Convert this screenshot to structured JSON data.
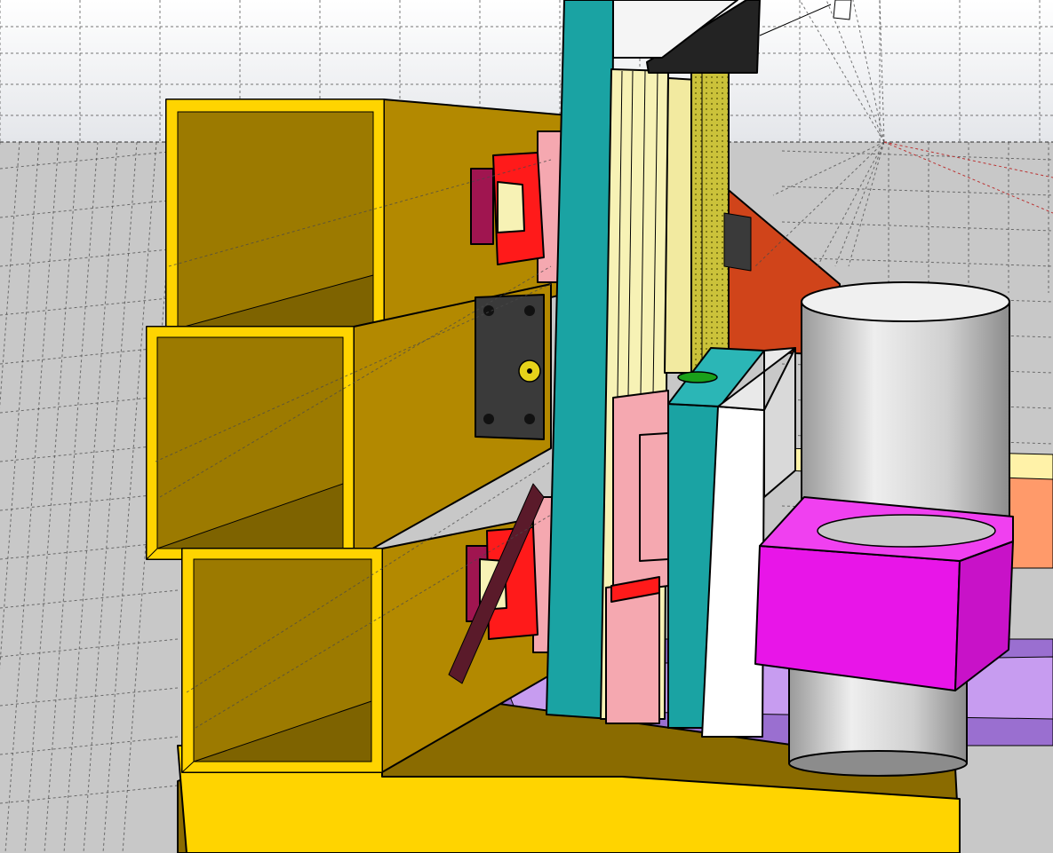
{
  "view": {
    "style": "shaded-with-hidden-lines",
    "projection": "perspective"
  },
  "colors": {
    "sky": "#eef0f2",
    "ground": "#c8c8c8",
    "gold_tube": "#c89a00",
    "gold_tube_outline": "#ffd400",
    "gold_tube_inner": "#9c7a00",
    "base_plate_top": "#8a6b00",
    "base_plate_front": "#ffd400",
    "teal_plate": "#1aa3a3",
    "rail_cream": "#f7f2b5",
    "rail_pink": "#f5a8b0",
    "carriage_red": "#ff1a1a",
    "carriage_cream": "#f7f2b5",
    "bearing_block": "#3a3a3a",
    "ballscrew": "#c9c23a",
    "wedge_orange": "#d0441a",
    "spindle_gray": "#d6d6d6",
    "clamp_magenta": "#e815e8",
    "purple_base": "#9a6fd0",
    "motor_mount_black": "#232323"
  },
  "parts": [
    {
      "name": "steel-tube-top",
      "icon": "square-tube-icon"
    },
    {
      "name": "steel-tube-middle",
      "icon": "square-tube-icon"
    },
    {
      "name": "steel-tube-bottom",
      "icon": "square-tube-icon"
    },
    {
      "name": "base-plate",
      "icon": "plate-icon"
    },
    {
      "name": "linear-rail-upper",
      "icon": "rail-icon"
    },
    {
      "name": "linear-rail-lower",
      "icon": "rail-icon"
    },
    {
      "name": "bearing-block",
      "icon": "bearing-icon"
    },
    {
      "name": "z-axis-plate",
      "icon": "plate-icon"
    },
    {
      "name": "ball-screw",
      "icon": "screw-icon"
    },
    {
      "name": "spindle-motor",
      "icon": "cylinder-icon"
    },
    {
      "name": "spindle-clamp",
      "icon": "clamp-icon"
    },
    {
      "name": "gantry-wedge",
      "icon": "wedge-icon"
    }
  ]
}
